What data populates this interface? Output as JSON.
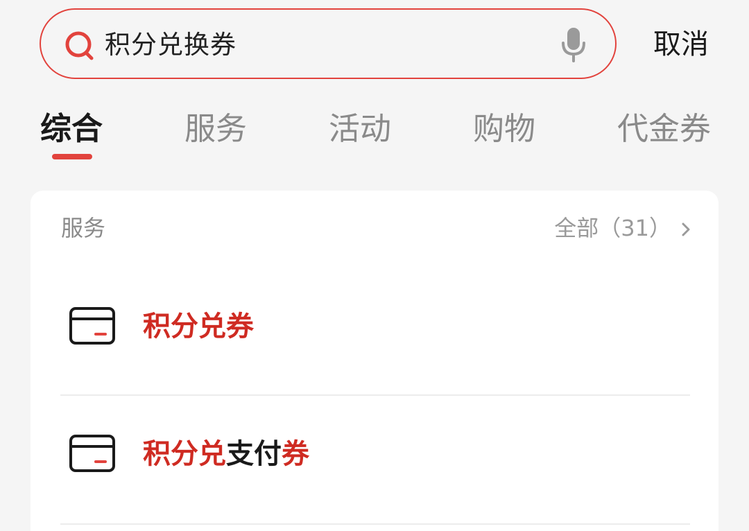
{
  "search": {
    "query": "积分兑换券",
    "icon": "search-icon",
    "voice_icon": "microphone-icon",
    "accent_color": "#e2433d",
    "cancel_label": "取消"
  },
  "tabs": [
    {
      "label": "综合",
      "active": true
    },
    {
      "label": "服务",
      "active": false
    },
    {
      "label": "活动",
      "active": false
    },
    {
      "label": "购物",
      "active": false
    },
    {
      "label": "代金券",
      "active": false
    }
  ],
  "services": {
    "title": "服务",
    "view_all": "全部（31）",
    "view_all_icon": "chevron-right-icon",
    "highlight_color": "#cf2b22",
    "items": [
      {
        "icon": "card-icon",
        "segments": [
          {
            "text": "积分兑券",
            "highlight": true
          }
        ]
      },
      {
        "icon": "card-icon",
        "segments": [
          {
            "text": "积分兑",
            "highlight": true
          },
          {
            "text": "支付",
            "highlight": false
          },
          {
            "text": "券",
            "highlight": true
          }
        ]
      }
    ]
  }
}
